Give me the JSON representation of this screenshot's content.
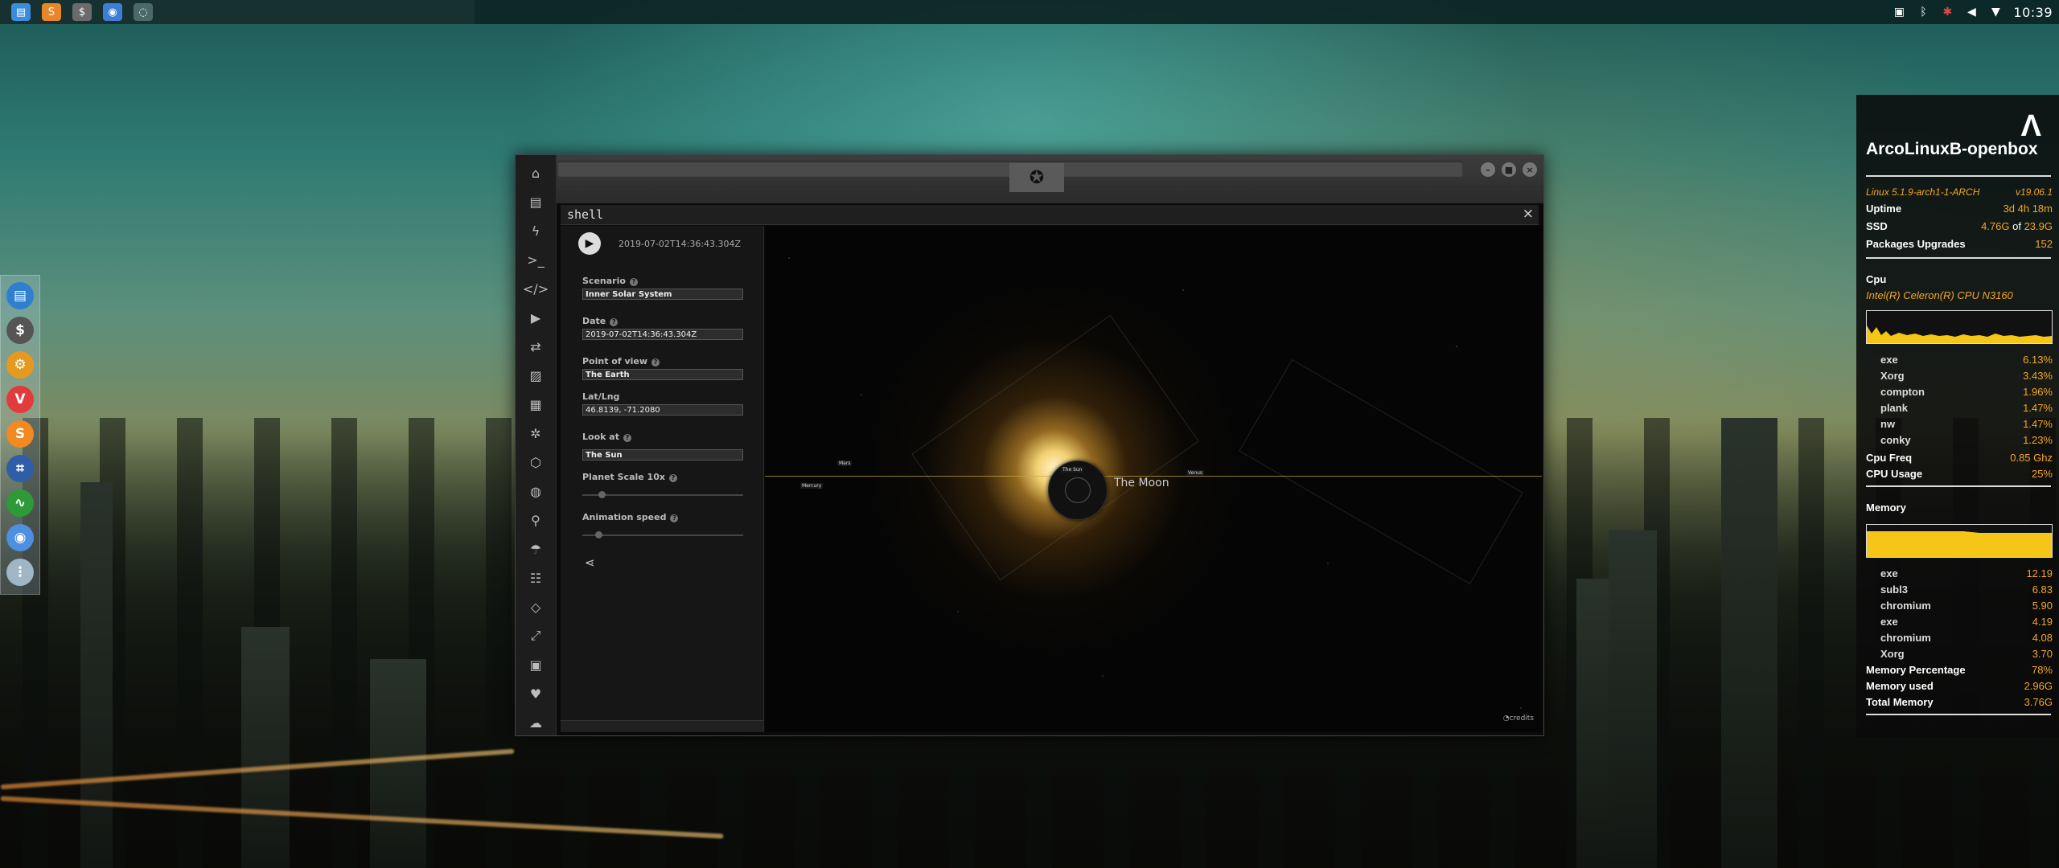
{
  "topbar": {
    "apps": [
      {
        "icon": "file-manager-icon",
        "color": "#3b8ddc",
        "glyph": "▤"
      },
      {
        "icon": "sublime-text-icon",
        "color": "#e8862a",
        "glyph": "S"
      },
      {
        "icon": "terminal-icon",
        "color": "#6b6b6b",
        "glyph": "$"
      },
      {
        "icon": "chromium-icon",
        "color": "#3c7ed6",
        "glyph": "◉"
      },
      {
        "icon": "app-window-icon",
        "color": "#4a6a6a",
        "glyph": "◌"
      }
    ],
    "clock": "10:39"
  },
  "dock": [
    {
      "name": "dock-file-manager-icon",
      "color": "#2e7fd0",
      "glyph": "▤"
    },
    {
      "name": "dock-terminal-icon",
      "color": "#555555",
      "glyph": "$"
    },
    {
      "name": "dock-settings-icon",
      "color": "#e59a1f",
      "glyph": "⚙"
    },
    {
      "name": "dock-vivaldi-icon",
      "color": "#e13b3b",
      "glyph": "V"
    },
    {
      "name": "dock-sublime-icon",
      "color": "#f18a22",
      "glyph": "S"
    },
    {
      "name": "dock-screenshot-icon",
      "color": "#2f5da8",
      "glyph": "⌗"
    },
    {
      "name": "dock-monitor-icon",
      "color": "#2e9a3a",
      "glyph": "∿"
    },
    {
      "name": "dock-chromium-icon",
      "color": "#4d8fe0",
      "glyph": "◉"
    },
    {
      "name": "dock-apps-icon",
      "color": "#9fb7c4",
      "glyph": "⋮"
    }
  ],
  "window": {
    "shell_title": "shell",
    "close_glyph": "×",
    "sidebar_icons": [
      "home-icon",
      "document-icon",
      "bolt-icon",
      "prompt-icon",
      "code-icon",
      "play-icon",
      "translate-icon",
      "image-icon",
      "news-icon",
      "atom-icon",
      "hexagon-icon",
      "globe-icon",
      "search-icon",
      "umbrella-icon",
      "contacts-icon",
      "embed-icon",
      "expand-icon",
      "youtube-icon",
      "heart-icon",
      "cloud-icon"
    ],
    "sidebar_glyphs": [
      "⌂",
      "▤",
      "ϟ",
      ">_",
      "</>",
      "▶",
      "⇄",
      "▨",
      "▦",
      "✲",
      "⬡",
      "◍",
      "⚲",
      "☂",
      "☷",
      "◇",
      "⤢",
      "▣",
      "♥",
      "☁"
    ]
  },
  "panel": {
    "timestamp": "2019-07-02T14:36:43.304Z",
    "scenario_label": "Scenario",
    "scenario_value": "Inner Solar System",
    "date_label": "Date",
    "date_value": "2019-07-02T14:36:43.304Z",
    "pov_label": "Point of view",
    "pov_value": "The Earth",
    "latlng_label": "Lat/Lng",
    "latlng_value": "46.8139, -71.2080",
    "lookat_label": "Look at",
    "lookat_value": "The Sun",
    "planet_scale_label": "Planet Scale 10x",
    "animation_speed_label": "Animation speed"
  },
  "space": {
    "moon_label": "The Moon",
    "sun_tag": "The Sun",
    "mars_tag": "Mars",
    "mercury_tag": "Mercury",
    "venus_tag": "Venus",
    "credits": "credits"
  },
  "conky": {
    "title": "ArcoLinuxB-openbox",
    "kernel": "Linux 5.1.9-arch1-1-ARCH",
    "version": "v19.06.1",
    "uptime_label": "Uptime",
    "uptime_value": "3d 4h 18m",
    "ssd_label": "SSD",
    "ssd_used": "4.76G",
    "ssd_of": "of",
    "ssd_total": "23.9G",
    "pkg_label": "Packages Upgrades",
    "pkg_value": "152",
    "cpu_heading": "Cpu",
    "cpu_model": "Intel(R) Celeron(R) CPU  N3160",
    "cpu_procs": [
      {
        "name": "exe",
        "val": "6.13%"
      },
      {
        "name": "Xorg",
        "val": "3.43%"
      },
      {
        "name": "compton",
        "val": "1.96%"
      },
      {
        "name": "plank",
        "val": "1.47%"
      },
      {
        "name": "nw",
        "val": "1.47%"
      },
      {
        "name": "conky",
        "val": "1.23%"
      }
    ],
    "cpu_freq_label": "Cpu Freq",
    "cpu_freq_value": "0.85 Ghz",
    "cpu_usage_label": "CPU Usage",
    "cpu_usage_value": "25%",
    "mem_heading": "Memory",
    "mem_procs": [
      {
        "name": "exe",
        "val": "12.19"
      },
      {
        "name": "subl3",
        "val": "6.83"
      },
      {
        "name": "chromium",
        "val": "5.90"
      },
      {
        "name": "exe",
        "val": "4.19"
      },
      {
        "name": "chromium",
        "val": "4.08"
      },
      {
        "name": "Xorg",
        "val": "3.70"
      }
    ],
    "mem_pct_label": "Memory Percentage",
    "mem_pct_value": "78%",
    "mem_used_label": "Memory used",
    "mem_used_value": "2.96G",
    "mem_total_label": "Total Memory",
    "mem_total_value": "3.76G",
    "accent": "#f5a623"
  }
}
